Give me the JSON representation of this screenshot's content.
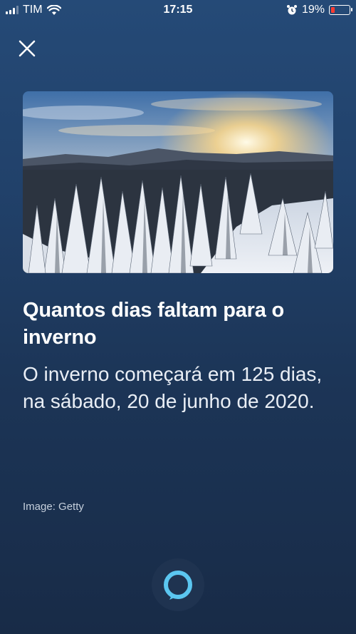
{
  "status_bar": {
    "carrier": "TIM",
    "time": "17:15",
    "battery": "19%",
    "battery_level": 0.19,
    "icons": [
      "signal-icon",
      "wifi-icon",
      "alarm-icon",
      "battery-icon"
    ]
  },
  "header": {
    "close_icon": "close-icon"
  },
  "card": {
    "image_icon": "winter-forest-image",
    "title": "Quantos dias faltam para o inverno",
    "body": "O inverno começará em 125 dias, na sábado, 20 de junho de 2020.",
    "credit": "Image: Getty"
  },
  "footer": {
    "alexa_icon": "alexa-icon"
  },
  "colors": {
    "background_top": "#254a77",
    "background_bottom": "#182b47",
    "alexa_ring": "#5bc6f0",
    "battery_low": "#ff3b30"
  }
}
